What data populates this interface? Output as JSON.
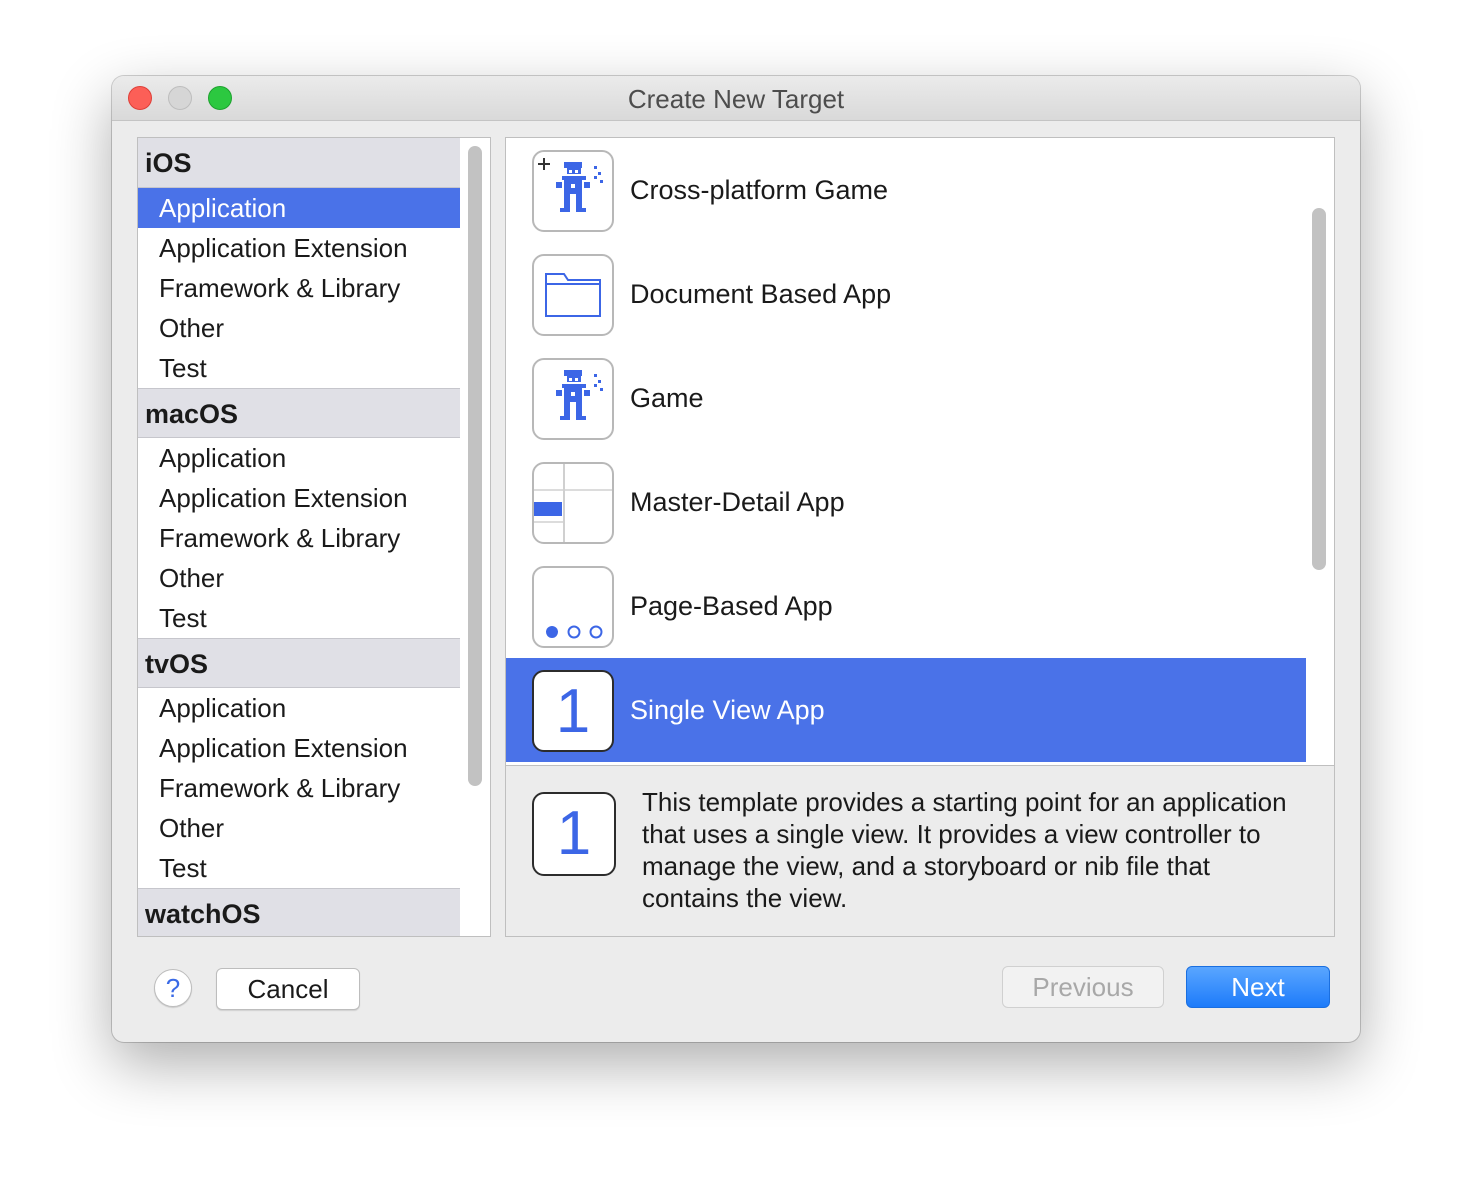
{
  "window": {
    "title": "Create New Target"
  },
  "categories": {
    "ios": {
      "header": "iOS",
      "items": [
        "Application",
        "Application Extension",
        "Framework & Library",
        "Other",
        "Test"
      ],
      "selected": "Application"
    },
    "macos": {
      "header": "macOS",
      "items": [
        "Application",
        "Application Extension",
        "Framework & Library",
        "Other",
        "Test"
      ]
    },
    "tvos": {
      "header": "tvOS",
      "items": [
        "Application",
        "Application Extension",
        "Framework & Library",
        "Other",
        "Test"
      ]
    },
    "watchos": {
      "header": "watchOS"
    }
  },
  "templates": [
    {
      "label": "Cross-platform Game",
      "icon": "cross-platform-game-icon"
    },
    {
      "label": "Document Based App",
      "icon": "folder-icon"
    },
    {
      "label": "Game",
      "icon": "game-character-icon"
    },
    {
      "label": "Master-Detail App",
      "icon": "master-detail-icon"
    },
    {
      "label": "Page-Based App",
      "icon": "page-dots-icon"
    },
    {
      "label": "Single View App",
      "icon": "single-view-icon",
      "icon_glyph": "1",
      "selected": true
    }
  ],
  "description": {
    "icon_glyph": "1",
    "text": "This template provides a starting point for an application that uses a single view. It provides a view controller to manage the view, and a storyboard or nib file that contains the view."
  },
  "buttons": {
    "help": "?",
    "cancel": "Cancel",
    "previous": "Previous",
    "next": "Next"
  },
  "colors": {
    "selection": "#4a72e8",
    "accent_blue": "#1d7bfa",
    "icon_blue": "#3c66e6"
  }
}
